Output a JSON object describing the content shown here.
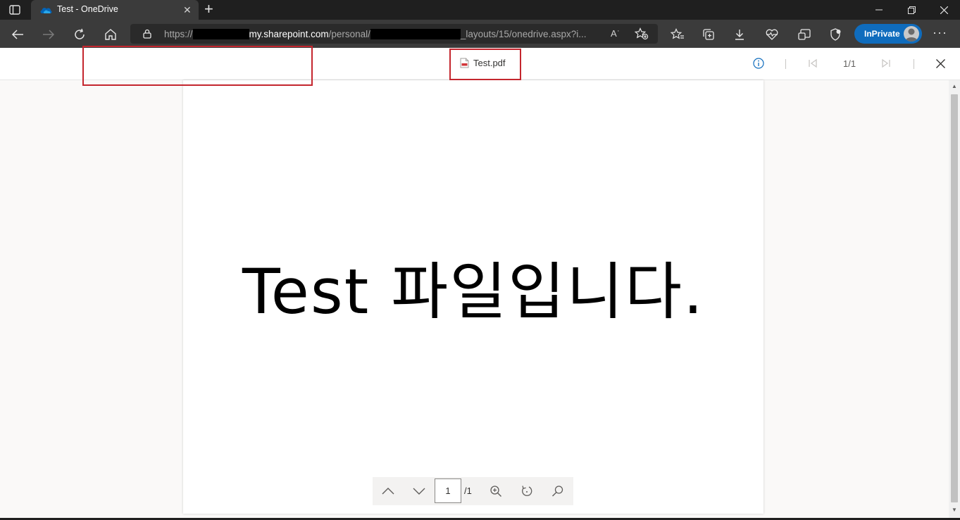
{
  "browser": {
    "tab_title": "Test - OneDrive",
    "url_prefix": "https://",
    "url_host": "my.sharepoint.com",
    "url_mid": "/personal/",
    "url_suffix": "_layouts/15/onedrive.aspx?i...",
    "read_aloud_label": "A͘",
    "inprivate_label": "InPrivate"
  },
  "viewer": {
    "file_name": "Test.pdf",
    "page_indicator": "1/1"
  },
  "document": {
    "text": "Test 파일입니다."
  },
  "page_controls": {
    "current_page": "1",
    "total": "/1"
  },
  "colors": {
    "highlight": "#c4262e",
    "inprivate": "#0f6cbd",
    "onedrive_cloud": "#0364b8"
  }
}
